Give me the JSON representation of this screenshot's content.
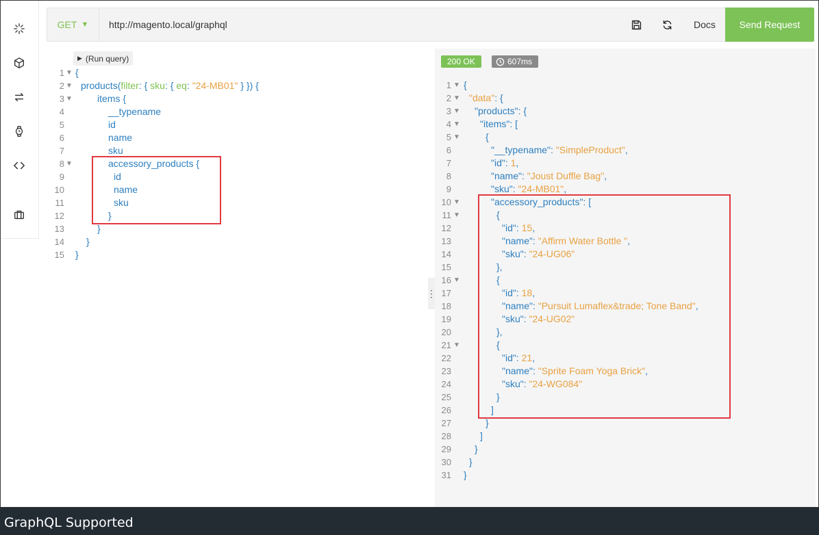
{
  "toolbar": {
    "method": "GET",
    "method_caret": "▼",
    "url": "http://magento.local/graphql",
    "docs_label": "Docs",
    "send_label": "Send Request"
  },
  "query": {
    "run_label": "(Run query)",
    "lines": [
      {
        "n": "1",
        "fold": true,
        "indent": 0,
        "parts": [
          [
            "b",
            "{"
          ]
        ]
      },
      {
        "n": "2",
        "fold": true,
        "indent": 8,
        "parts": [
          [
            "k",
            "products("
          ],
          [
            "g",
            "filter"
          ],
          [
            "k",
            ": { "
          ],
          [
            "g",
            "sku"
          ],
          [
            "k",
            ": { "
          ],
          [
            "g",
            "eq"
          ],
          [
            "k",
            ": "
          ],
          [
            "s",
            "\"24-MB01\""
          ],
          [
            "k",
            " } }) {"
          ]
        ]
      },
      {
        "n": "3",
        "fold": true,
        "indent": 32,
        "parts": [
          [
            "k",
            "items {"
          ]
        ]
      },
      {
        "n": "4",
        "fold": false,
        "indent": 48,
        "parts": [
          [
            "k",
            "__typename"
          ]
        ]
      },
      {
        "n": "5",
        "fold": false,
        "indent": 48,
        "parts": [
          [
            "k",
            "id"
          ]
        ]
      },
      {
        "n": "6",
        "fold": false,
        "indent": 48,
        "parts": [
          [
            "k",
            "name"
          ]
        ]
      },
      {
        "n": "7",
        "fold": false,
        "indent": 48,
        "parts": [
          [
            "k",
            "sku"
          ]
        ]
      },
      {
        "n": "8",
        "fold": true,
        "indent": 48,
        "parts": [
          [
            "k",
            "accessory_products {"
          ]
        ]
      },
      {
        "n": "9",
        "fold": false,
        "indent": 56,
        "parts": [
          [
            "k",
            "id"
          ]
        ]
      },
      {
        "n": "10",
        "fold": false,
        "indent": 56,
        "parts": [
          [
            "k",
            "name"
          ]
        ]
      },
      {
        "n": "11",
        "fold": false,
        "indent": 56,
        "parts": [
          [
            "k",
            "sku"
          ]
        ]
      },
      {
        "n": "12",
        "fold": false,
        "indent": 48,
        "parts": [
          [
            "k",
            "}"
          ]
        ]
      },
      {
        "n": "13",
        "fold": false,
        "indent": 32,
        "parts": [
          [
            "k",
            "}"
          ]
        ]
      },
      {
        "n": "14",
        "fold": false,
        "indent": 16,
        "parts": [
          [
            "k",
            "}"
          ]
        ]
      },
      {
        "n": "15",
        "fold": false,
        "indent": 0,
        "parts": [
          [
            "b",
            "}"
          ]
        ]
      }
    ]
  },
  "response": {
    "status": "200 OK",
    "time": "607ms",
    "lines": [
      {
        "n": "1",
        "fold": true,
        "indent": 0,
        "parts": [
          [
            "b",
            "{"
          ]
        ]
      },
      {
        "n": "2",
        "fold": true,
        "indent": 8,
        "parts": [
          [
            "s",
            "\"data\""
          ],
          [
            "k",
            ": {"
          ]
        ]
      },
      {
        "n": "3",
        "fold": true,
        "indent": 16,
        "parts": [
          [
            "k",
            "\"products\": {"
          ]
        ]
      },
      {
        "n": "4",
        "fold": true,
        "indent": 24,
        "parts": [
          [
            "k",
            "\"items\": ["
          ]
        ]
      },
      {
        "n": "5",
        "fold": true,
        "indent": 32,
        "parts": [
          [
            "k",
            "{"
          ]
        ]
      },
      {
        "n": "6",
        "fold": false,
        "indent": 40,
        "parts": [
          [
            "k",
            "\"__typename\": "
          ],
          [
            "s",
            "\"SimpleProduct\""
          ],
          [
            "k",
            ","
          ]
        ]
      },
      {
        "n": "7",
        "fold": false,
        "indent": 40,
        "parts": [
          [
            "k",
            "\"id\": "
          ],
          [
            "n",
            "1"
          ],
          [
            "k",
            ","
          ]
        ]
      },
      {
        "n": "8",
        "fold": false,
        "indent": 40,
        "parts": [
          [
            "k",
            "\"name\": "
          ],
          [
            "s",
            "\"Joust Duffle Bag\""
          ],
          [
            "k",
            ","
          ]
        ]
      },
      {
        "n": "9",
        "fold": false,
        "indent": 40,
        "parts": [
          [
            "k",
            "\"sku\": "
          ],
          [
            "s",
            "\"24-MB01\""
          ],
          [
            "k",
            ","
          ]
        ]
      },
      {
        "n": "10",
        "fold": true,
        "indent": 40,
        "parts": [
          [
            "k",
            "\"accessory_products\": ["
          ]
        ]
      },
      {
        "n": "11",
        "fold": true,
        "indent": 48,
        "parts": [
          [
            "k",
            "{"
          ]
        ]
      },
      {
        "n": "12",
        "fold": false,
        "indent": 56,
        "parts": [
          [
            "k",
            "\"id\": "
          ],
          [
            "n",
            "15"
          ],
          [
            "k",
            ","
          ]
        ]
      },
      {
        "n": "13",
        "fold": false,
        "indent": 56,
        "parts": [
          [
            "k",
            "\"name\": "
          ],
          [
            "s",
            "\"Affirm Water Bottle \""
          ],
          [
            "k",
            ","
          ]
        ]
      },
      {
        "n": "14",
        "fold": false,
        "indent": 56,
        "parts": [
          [
            "k",
            "\"sku\": "
          ],
          [
            "s",
            "\"24-UG06\""
          ]
        ]
      },
      {
        "n": "15",
        "fold": false,
        "indent": 48,
        "parts": [
          [
            "k",
            "},"
          ]
        ]
      },
      {
        "n": "16",
        "fold": true,
        "indent": 48,
        "parts": [
          [
            "k",
            "{"
          ]
        ]
      },
      {
        "n": "17",
        "fold": false,
        "indent": 56,
        "parts": [
          [
            "k",
            "\"id\": "
          ],
          [
            "n",
            "18"
          ],
          [
            "k",
            ","
          ]
        ]
      },
      {
        "n": "18",
        "fold": false,
        "indent": 56,
        "parts": [
          [
            "k",
            "\"name\": "
          ],
          [
            "s",
            "\"Pursuit Lumaflex&trade; Tone Band\""
          ],
          [
            "k",
            ","
          ]
        ]
      },
      {
        "n": "19",
        "fold": false,
        "indent": 56,
        "parts": [
          [
            "k",
            "\"sku\": "
          ],
          [
            "s",
            "\"24-UG02\""
          ]
        ]
      },
      {
        "n": "20",
        "fold": false,
        "indent": 48,
        "parts": [
          [
            "k",
            "},"
          ]
        ]
      },
      {
        "n": "21",
        "fold": true,
        "indent": 48,
        "parts": [
          [
            "k",
            "{"
          ]
        ]
      },
      {
        "n": "22",
        "fold": false,
        "indent": 56,
        "parts": [
          [
            "k",
            "\"id\": "
          ],
          [
            "n",
            "21"
          ],
          [
            "k",
            ","
          ]
        ]
      },
      {
        "n": "23",
        "fold": false,
        "indent": 56,
        "parts": [
          [
            "k",
            "\"name\": "
          ],
          [
            "s",
            "\"Sprite Foam Yoga Brick\""
          ],
          [
            "k",
            ","
          ]
        ]
      },
      {
        "n": "24",
        "fold": false,
        "indent": 56,
        "parts": [
          [
            "k",
            "\"sku\": "
          ],
          [
            "s",
            "\"24-WG084\""
          ]
        ]
      },
      {
        "n": "25",
        "fold": false,
        "indent": 48,
        "parts": [
          [
            "k",
            "}"
          ]
        ]
      },
      {
        "n": "26",
        "fold": false,
        "indent": 40,
        "parts": [
          [
            "k",
            "]"
          ]
        ]
      },
      {
        "n": "27",
        "fold": false,
        "indent": 32,
        "parts": [
          [
            "k",
            "}"
          ]
        ]
      },
      {
        "n": "28",
        "fold": false,
        "indent": 24,
        "parts": [
          [
            "k",
            "]"
          ]
        ]
      },
      {
        "n": "29",
        "fold": false,
        "indent": 16,
        "parts": [
          [
            "k",
            "}"
          ]
        ]
      },
      {
        "n": "30",
        "fold": false,
        "indent": 8,
        "parts": [
          [
            "k",
            "}"
          ]
        ]
      },
      {
        "n": "31",
        "fold": false,
        "indent": 0,
        "parts": [
          [
            "b",
            "}"
          ]
        ]
      }
    ]
  },
  "caption": "GraphQL Supported",
  "colors": {
    "accent_green": "#7dc257",
    "key_blue": "#2d7fbf",
    "string_orange": "#e8a142",
    "highlight_red": "#e0393e",
    "caption_bg": "#232b33"
  },
  "icons": [
    "loader-icon",
    "cube-icon",
    "swap-icon",
    "watch-icon",
    "code-icon",
    "briefcase-icon",
    "save-icon",
    "refresh-icon",
    "clock-icon"
  ]
}
